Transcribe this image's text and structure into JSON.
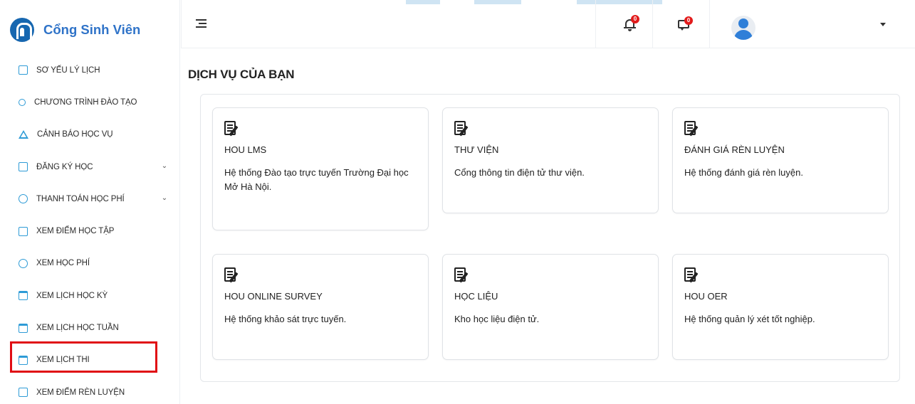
{
  "sidebar": {
    "brand": "Cổng Sinh Viên",
    "items": [
      {
        "label": "SƠ YẾU LÝ LỊCH",
        "icon": "profile-icon",
        "expandable": false
      },
      {
        "label": "CHƯƠNG TRÌNH ĐÀO TẠO",
        "icon": "program-icon",
        "expandable": false
      },
      {
        "label": "CẢNH BÁO HỌC VỤ",
        "icon": "warning-icon",
        "expandable": false
      },
      {
        "label": "ĐĂNG KÝ HỌC",
        "icon": "edit-icon",
        "expandable": true
      },
      {
        "label": "THANH TOÁN HỌC PHÍ",
        "icon": "payment-icon",
        "expandable": true
      },
      {
        "label": "XEM ĐIỂM HỌC TẬP",
        "icon": "grade-icon",
        "expandable": false
      },
      {
        "label": "XEM HỌC PHÍ",
        "icon": "fee-icon",
        "expandable": false
      },
      {
        "label": "XEM LỊCH HỌC KỲ",
        "icon": "calendar-icon",
        "expandable": false
      },
      {
        "label": "XEM LỊCH HỌC TUẦN",
        "icon": "calendar-icon",
        "expandable": false
      },
      {
        "label": "XEM LỊCH THI",
        "icon": "calendar-icon",
        "expandable": false,
        "highlighted": true
      },
      {
        "label": "XEM ĐIỂM RÈN LUYỆN",
        "icon": "grade-icon",
        "expandable": false
      }
    ]
  },
  "header": {
    "notifications_count": "0",
    "messages_count": "0"
  },
  "main": {
    "title": "DỊCH VỤ CỦA BẠN",
    "cards": [
      {
        "title": "HOU LMS",
        "desc": "Hệ thống Đào tạo trực tuyến Trường Đại học Mở Hà Nội."
      },
      {
        "title": "THƯ VIỆN",
        "desc": "Cổng thông tin điện tử thư viện."
      },
      {
        "title": "ĐÁNH GIÁ RÈN LUYỆN",
        "desc": "Hệ thống đánh giá rèn luyện."
      },
      {
        "title": "HOU ONLINE SURVEY",
        "desc": "Hệ thống khảo sát trực tuyến."
      },
      {
        "title": "HỌC LIỆU",
        "desc": "Kho học liệu điện tử."
      },
      {
        "title": "HOU OER",
        "desc": "Hệ thống quản lý xét tốt nghiệp."
      }
    ]
  },
  "colors": {
    "brand": "#2f73c8",
    "icon_accent": "#2e9bd6",
    "highlight_box": "#e00d14",
    "badge": "#e21b1b"
  }
}
